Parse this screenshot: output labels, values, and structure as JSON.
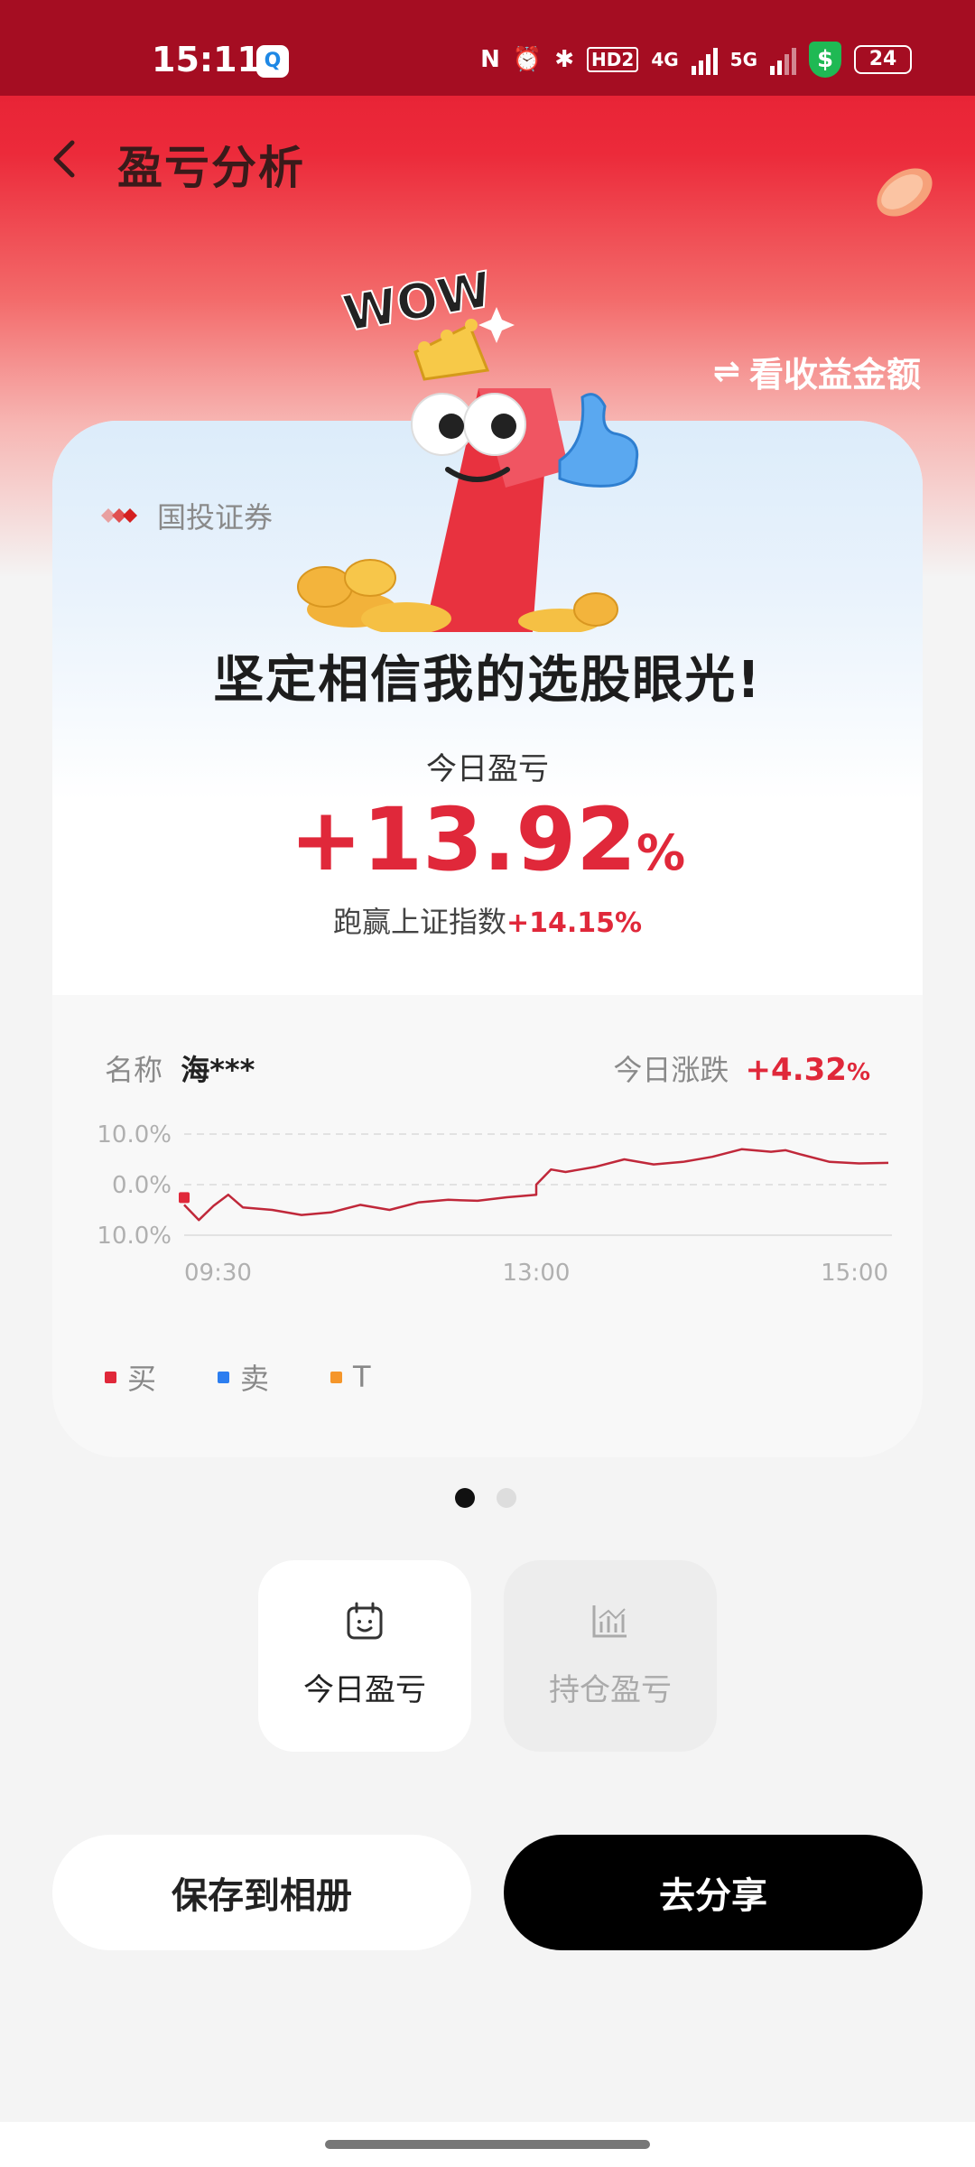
{
  "status_bar": {
    "time": "15:11",
    "app_icon": "Q",
    "network_4g": "4G",
    "network_5g": "5G",
    "hd": "HD2",
    "shield": "$",
    "battery": "24"
  },
  "header": {
    "title": "盈亏分析",
    "toggle_label": "看收益金额",
    "toggle_icon": "⇌",
    "mascot_text": "WOW"
  },
  "card": {
    "broker": "国投证券",
    "headline": "坚定相信我的选股眼光!",
    "pl_label": "今日盈亏",
    "pl_number": "+13.92",
    "pl_unit": "%",
    "beat_label": "跑赢上证指数",
    "beat_value": "+14.15%",
    "name_label": "名称",
    "name_value": "海***",
    "change_label": "今日涨跌",
    "change_number": "+4.32",
    "change_unit": "%"
  },
  "chart_data": {
    "type": "line",
    "y_ticks": [
      "10.0%",
      "0.0%",
      "-10.0%"
    ],
    "x_ticks": [
      "09:30",
      "13:00",
      "15:00"
    ],
    "ylim": [
      -10,
      10
    ],
    "grid": true,
    "series": [
      {
        "name": "",
        "color": "#c0283a",
        "x": [
          "09:30",
          "09:35",
          "09:40",
          "09:45",
          "09:50",
          "10:00",
          "10:10",
          "10:20",
          "10:30",
          "10:40",
          "10:50",
          "11:00",
          "11:10",
          "11:20",
          "11:30",
          "13:00",
          "13:05",
          "13:10",
          "13:15",
          "13:20",
          "13:30",
          "13:40",
          "13:50",
          "14:00",
          "14:10",
          "14:20",
          "14:25",
          "14:30",
          "14:40",
          "14:50",
          "15:00"
        ],
        "values": [
          -4.0,
          -7.0,
          -4.2,
          -2.0,
          -4.5,
          -5.0,
          -6.0,
          -5.5,
          -4.0,
          -5.0,
          -3.5,
          -3.0,
          -3.2,
          -2.5,
          -2.0,
          0.0,
          3.0,
          2.5,
          3.0,
          3.5,
          5.0,
          4.0,
          4.5,
          5.5,
          7.0,
          6.5,
          6.8,
          6.0,
          4.5,
          4.2,
          4.3
        ]
      }
    ],
    "markers": [
      {
        "x": "09:30",
        "value": -4.0,
        "type": "buy"
      }
    ],
    "legend": [
      {
        "label": "买",
        "color": "#e0283a"
      },
      {
        "label": "卖",
        "color": "#2c7ef0"
      },
      {
        "label": "T",
        "color": "#f5962a"
      }
    ]
  },
  "pager": {
    "total": 2,
    "active": 0
  },
  "tabs": [
    {
      "label": "今日盈亏",
      "icon": "calendar-smile-icon",
      "active": true
    },
    {
      "label": "持仓盈亏",
      "icon": "bar-chart-icon",
      "active": false
    }
  ],
  "actions": {
    "save_label": "保存到相册",
    "share_label": "去分享"
  }
}
